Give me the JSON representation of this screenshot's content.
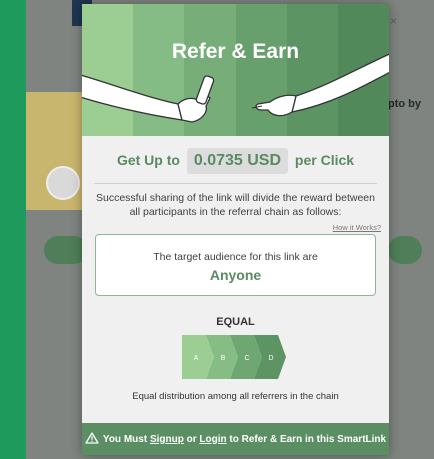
{
  "background": {
    "right_text": "pto by",
    "close_glyph": "×"
  },
  "modal": {
    "title": "Refer & Earn",
    "header_colors": [
      "#9ccd92",
      "#85bc85",
      "#76ad79",
      "#67a06d",
      "#5c9463",
      "#52895b"
    ],
    "price": {
      "prefix": "Get Up to",
      "amount": "0.0735 USD",
      "suffix": "per Click"
    },
    "description": "Successful sharing of the link will divide the reward between all participants in the referral chain as follows:",
    "how_link": "How it Works?",
    "audience": {
      "label": "The target audience for this link are",
      "value": "Anyone"
    },
    "distribution": {
      "title": "EQUAL",
      "segments": [
        "A",
        "B",
        "C",
        "D"
      ],
      "segment_colors": [
        "#9ccd92",
        "#86bd85",
        "#6fa773",
        "#5c9463"
      ],
      "caption": "Equal distribution among all referrers in the chain"
    },
    "footer": {
      "before": "You Must",
      "signup": "Signup",
      "or": "or",
      "login": "Login",
      "after": "to Refer & Earn in this SmartLink"
    }
  }
}
